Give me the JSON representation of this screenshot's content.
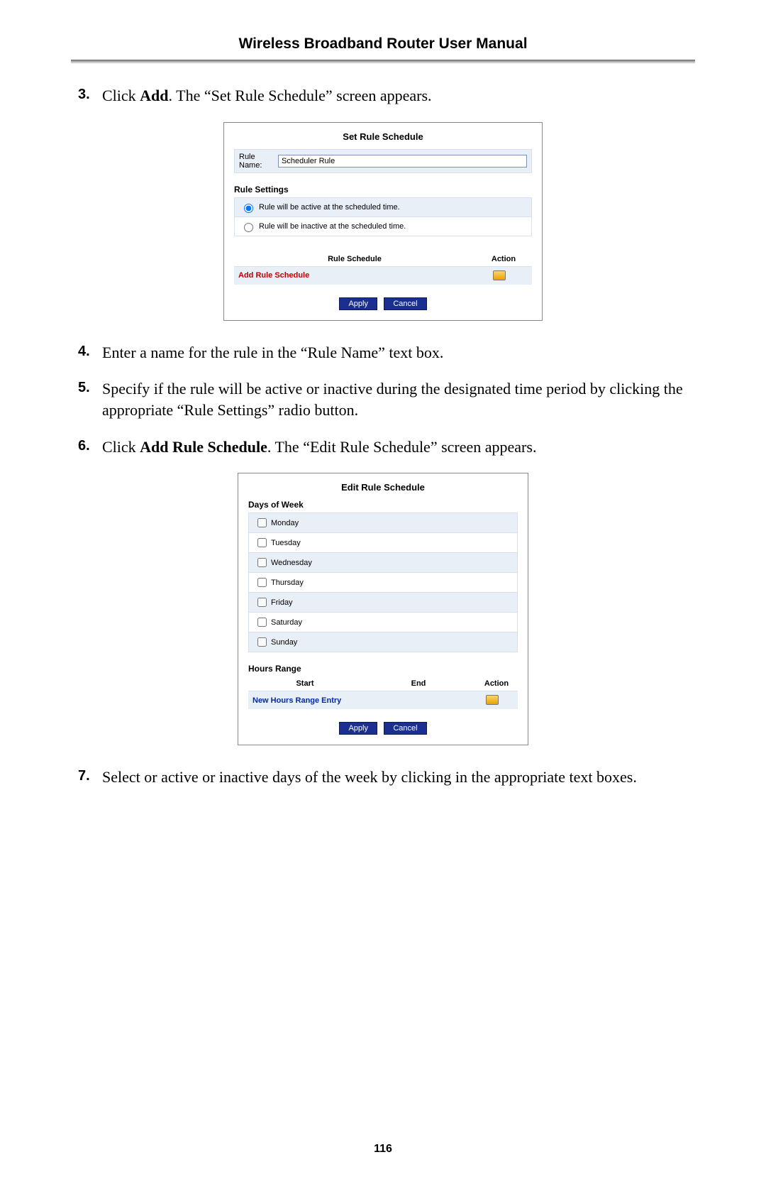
{
  "header": "Wireless Broadband Router User Manual",
  "steps": {
    "s3": {
      "num": "3.",
      "pre": "Click ",
      "bold": "Add",
      "post": ". The “Set Rule Schedule” screen appears."
    },
    "s4": {
      "num": "4.",
      "text": "Enter a name for the rule in the “Rule Name” text box."
    },
    "s5": {
      "num": "5.",
      "text": "Specify if the rule will be active or inactive during the designated time period by clicking the appropriate “Rule Settings” radio button."
    },
    "s6": {
      "num": "6.",
      "pre": "Click ",
      "bold": "Add Rule Schedule",
      "post": ". The “Edit Rule Schedule” screen appears."
    },
    "s7": {
      "num": "7.",
      "text": "Select or active or inactive days of the week by clicking in the appropriate text boxes."
    }
  },
  "fig1": {
    "title": "Set Rule Schedule",
    "rule_name_label": "Rule Name:",
    "rule_name_value": "Scheduler Rule",
    "settings_heading": "Rule Settings",
    "opt_active": "Rule will be active at the scheduled time.",
    "opt_inactive": "Rule will be inactive at the scheduled time.",
    "sched_col": "Rule Schedule",
    "action_col": "Action",
    "add_link": "Add Rule Schedule",
    "apply": "Apply",
    "cancel": "Cancel"
  },
  "fig2": {
    "title": "Edit Rule Schedule",
    "days_heading": "Days of Week",
    "days": [
      "Monday",
      "Tuesday",
      "Wednesday",
      "Thursday",
      "Friday",
      "Saturday",
      "Sunday"
    ],
    "hours_heading": "Hours Range",
    "start_col": "Start",
    "end_col": "End",
    "action_col": "Action",
    "new_entry": "New Hours Range Entry",
    "apply": "Apply",
    "cancel": "Cancel"
  },
  "page_number": "116"
}
